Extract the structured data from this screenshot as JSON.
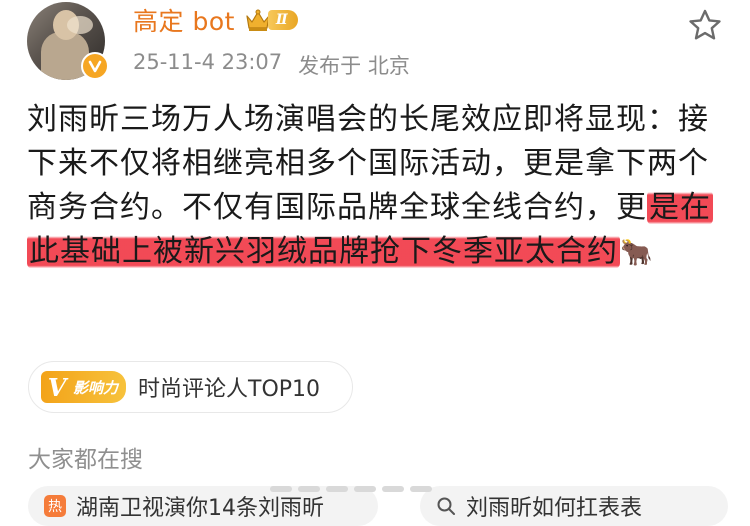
{
  "author": {
    "name": "高定 bot",
    "level": "Ⅱ",
    "avatar_icon": "avatar-photo",
    "verified_icon": "verified-v-badge-icon"
  },
  "meta": {
    "timestamp": "25-11-4 23:07",
    "location": "发布于 北京"
  },
  "actions": {
    "favorite_icon": "star-outline-icon"
  },
  "post": {
    "text_plain": "刘雨昕三场万人场演唱会的长尾效应即将显现：接下来不仅将相继亮相多个国际活动，更是拿下两个商务合约。不仅有国际品牌全球全线合约，更",
    "text_highlighted": "是在此基础上被新兴羽绒品牌抢下冬季亚太合约",
    "emoji": "🐂",
    "highlight_color": "#f13a48"
  },
  "influence": {
    "logo_v": "V",
    "logo_text": "影响力",
    "label": "时尚评论人TOP10"
  },
  "search": {
    "title": "大家都在搜",
    "suggestions": [
      {
        "tag": "热",
        "text": "湖南卫视演你14条刘雨昕"
      },
      {
        "text": "刘雨昕如何扛表表"
      }
    ]
  },
  "colors": {
    "name": "#e8771e",
    "meta": "#8c8c8c",
    "badge_gold": "#f0b02e"
  }
}
